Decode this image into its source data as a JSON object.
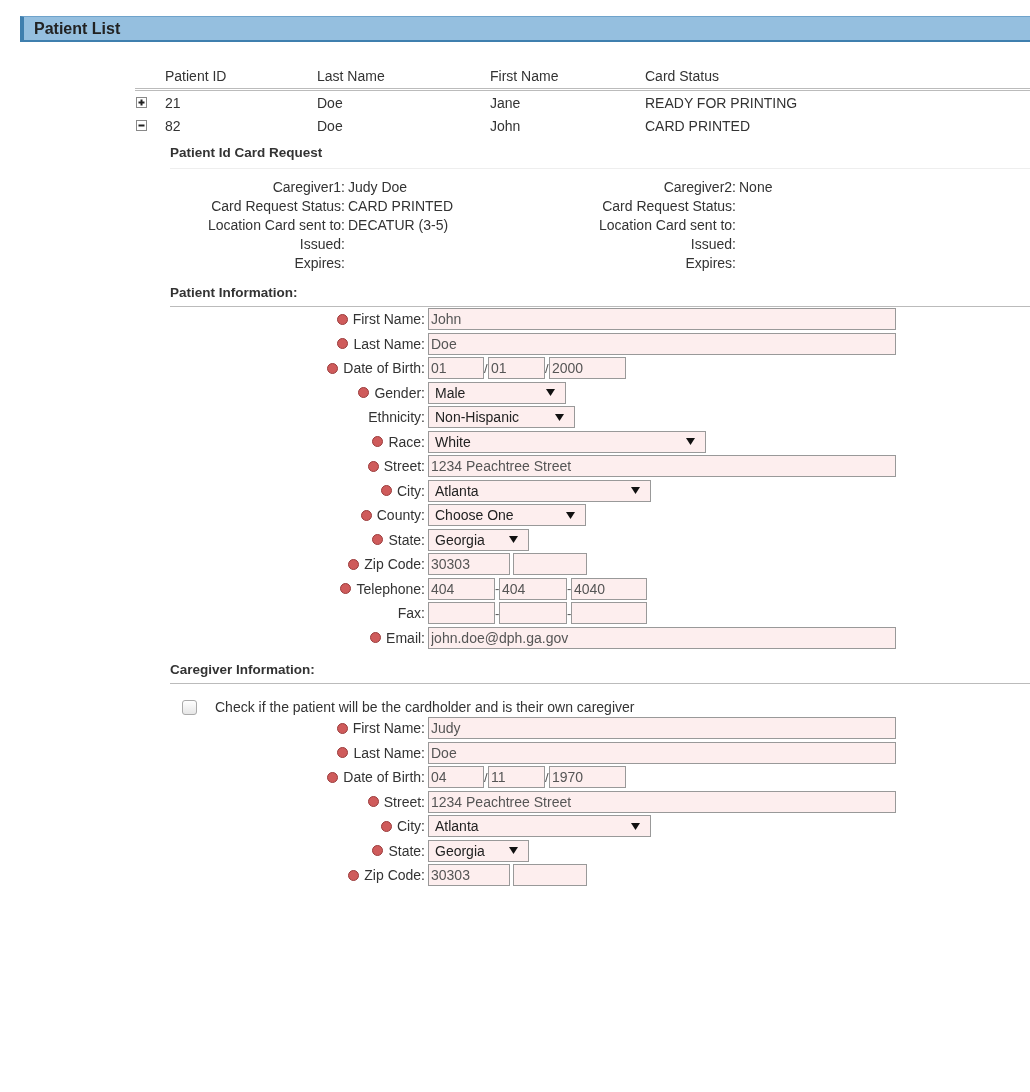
{
  "header": {
    "title": "Patient List"
  },
  "table": {
    "columns": [
      "Patient ID",
      "Last Name",
      "First Name",
      "Card Status"
    ],
    "rows": [
      {
        "expanded": false,
        "cells": [
          "21",
          "Doe",
          "Jane",
          "READY FOR PRINTING"
        ]
      },
      {
        "expanded": true,
        "cells": [
          "82",
          "Doe",
          "John",
          "CARD PRINTED"
        ],
        "detail": {
          "card_request": {
            "title": "Patient Id Card Request",
            "columns": [
              [
                {
                  "label": "Caregiver1:",
                  "value": "Judy Doe"
                },
                {
                  "label": "Card Request Status:",
                  "value": "CARD PRINTED"
                },
                {
                  "label": "Location Card sent to:",
                  "value": "DECATUR (3-5)"
                },
                {
                  "label": "Issued:"
                },
                {
                  "label": "Expires:"
                }
              ],
              [
                {
                  "label": "Caregiver2:",
                  "value": "None"
                },
                {
                  "label": "Card Request Status:"
                },
                {
                  "label": "Location Card sent to:"
                },
                {
                  "label": "Issued:"
                },
                {
                  "label": "Expires:"
                }
              ]
            ]
          },
          "patient_info": {
            "title": "Patient Information:",
            "fields": [
              {
                "label": "First Name:",
                "required": true,
                "kind": "text",
                "value": "John"
              },
              {
                "label": "Last Name:",
                "required": true,
                "kind": "text",
                "value": "Doe"
              },
              {
                "label": "Date of Birth:",
                "required": true,
                "kind": "split",
                "separators": [
                  "/",
                  "/"
                ],
                "values": [
                  "01",
                  "01",
                  "2000"
                ]
              },
              {
                "label": "Gender:",
                "required": true,
                "kind": "select",
                "value": "Male"
              },
              {
                "label": "Ethnicity:",
                "required": false,
                "kind": "select",
                "value": "Non-Hispanic"
              },
              {
                "label": "Race:",
                "required": true,
                "kind": "select",
                "value": "White"
              },
              {
                "label": "Street:",
                "required": true,
                "kind": "text",
                "value": "1234 Peachtree Street"
              },
              {
                "label": "City:",
                "required": true,
                "kind": "select",
                "value": "Atlanta"
              },
              {
                "label": "County:",
                "required": true,
                "kind": "select",
                "value": "Choose One"
              },
              {
                "label": "State:",
                "required": true,
                "kind": "select",
                "value": "Georgia"
              },
              {
                "label": "Zip Code:",
                "required": true,
                "kind": "split",
                "values": [
                  "30303"
                ]
              },
              {
                "label": "Telephone:",
                "required": true,
                "kind": "split",
                "separators": [
                  "-",
                  "-"
                ],
                "values": [
                  "404",
                  "404",
                  "4040"
                ]
              },
              {
                "label": "Fax:",
                "required": false,
                "kind": "split",
                "separators": [
                  "-",
                  "-"
                ]
              },
              {
                "label": "Email:",
                "required": true,
                "kind": "text",
                "value": "john.doe@dph.ga.gov"
              }
            ]
          },
          "caregiver_info": {
            "title": "Caregiver Information:",
            "checkbox": {
              "label": "Check if the patient will be the cardholder and is their own caregiver",
              "checked": false
            },
            "fields": [
              {
                "label": "First Name:",
                "required": true,
                "kind": "text",
                "value": "Judy"
              },
              {
                "label": "Last Name:",
                "required": true,
                "kind": "text",
                "value": "Doe"
              },
              {
                "label": "Date of Birth:",
                "required": true,
                "kind": "split",
                "separators": [
                  "/",
                  "/"
                ],
                "values": [
                  "04",
                  "11",
                  "1970"
                ]
              },
              {
                "label": "Street:",
                "required": true,
                "kind": "text",
                "value": "1234 Peachtree Street"
              },
              {
                "label": "City:",
                "required": true,
                "kind": "select",
                "value": "Atlanta"
              },
              {
                "label": "State:",
                "required": true,
                "kind": "select",
                "value": "Georgia"
              },
              {
                "label": "Zip Code:",
                "required": true,
                "kind": "split",
                "values": [
                  "30303"
                ]
              }
            ]
          }
        }
      }
    ]
  }
}
